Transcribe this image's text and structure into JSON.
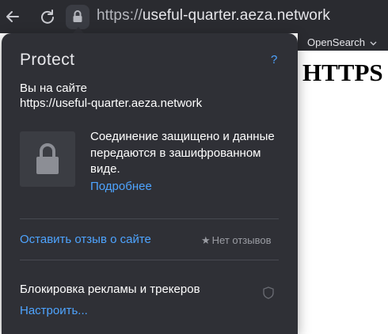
{
  "browser": {
    "url_scheme": "https://",
    "url_host": "useful-quarter.aeza.network",
    "search_engine": "OpenSearch"
  },
  "page": {
    "heading": "HTTPS"
  },
  "popup": {
    "title": "Protect",
    "help": "?",
    "site_label": "Вы на сайте",
    "site_url": "https://useful-quarter.aeza.network",
    "connection_text": "Соединение защищено и данные передаются в зашифрованном виде.",
    "more_link": "Подробнее",
    "feedback_link": "Оставить отзыв о сайте",
    "star": "★",
    "reviews_text": "Нет отзывов",
    "adblock_label": "Блокировка рекламы и трекеров",
    "configure_link": "Настроить..."
  },
  "colors": {
    "toolbar_bg": "#2a2b30",
    "popup_bg": "#2f3036",
    "link": "#4ea4ff",
    "text": "#ffffff",
    "muted": "#9a9ca3"
  },
  "icons": [
    "back-arrow-icon",
    "reload-icon",
    "lock-icon",
    "chevron-down-icon",
    "padlock-icon",
    "star-icon",
    "shield-icon"
  ]
}
